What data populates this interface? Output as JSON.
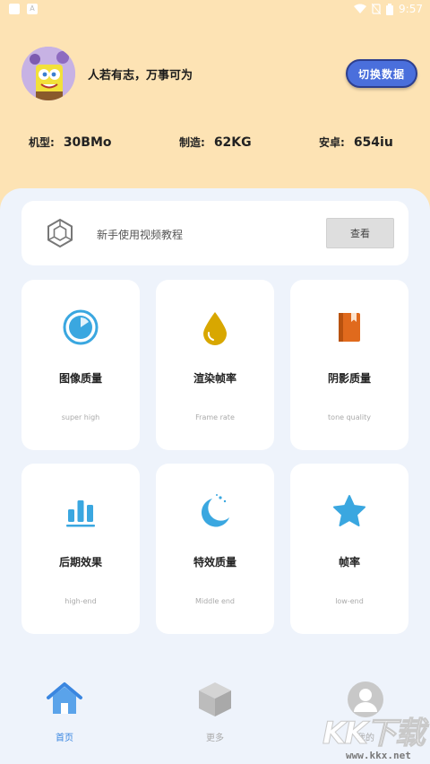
{
  "status_bar": {
    "time": "9:57",
    "notification_glyph": "A"
  },
  "profile": {
    "motto": "人若有志，万事可为",
    "switch_button": "切换数据"
  },
  "specs": [
    {
      "key": "机型:",
      "value": "30BMo"
    },
    {
      "key": "制造:",
      "value": "62KG"
    },
    {
      "key": "安卓:",
      "value": "654iu"
    }
  ],
  "tutorial": {
    "text": "新手使用视频教程",
    "button": "查看"
  },
  "cards": [
    {
      "title": "图像质量",
      "subtitle": "super high",
      "icon": "gauge-icon",
      "color": "#3aa7e0"
    },
    {
      "title": "渲染帧率",
      "subtitle": "Frame rate",
      "icon": "drop-icon",
      "color": "#d8a700"
    },
    {
      "title": "阴影质量",
      "subtitle": "tone quality",
      "icon": "book-icon",
      "color": "#e06a1d"
    },
    {
      "title": "后期效果",
      "subtitle": "high-end",
      "icon": "bar-chart-icon",
      "color": "#3aa7e0"
    },
    {
      "title": "特效质量",
      "subtitle": "Middle end",
      "icon": "moon-icon",
      "color": "#3aa7e0"
    },
    {
      "title": "帧率",
      "subtitle": "low-end",
      "icon": "star-icon",
      "color": "#3aa7e0"
    }
  ],
  "nav": [
    {
      "label": "首页",
      "icon": "home-icon",
      "active": true
    },
    {
      "label": "更多",
      "icon": "cube-icon",
      "active": false
    },
    {
      "label": "我的",
      "icon": "user-icon",
      "active": false
    }
  ],
  "watermark": {
    "big": "KK下载",
    "small": "www.kkx.net"
  },
  "colors": {
    "header_bg": "#fde3b4",
    "main_bg": "#eef3fb",
    "accent": "#4a6fdc",
    "active_nav": "#3a86e0",
    "inactive_nav": "#bbbbbb"
  }
}
